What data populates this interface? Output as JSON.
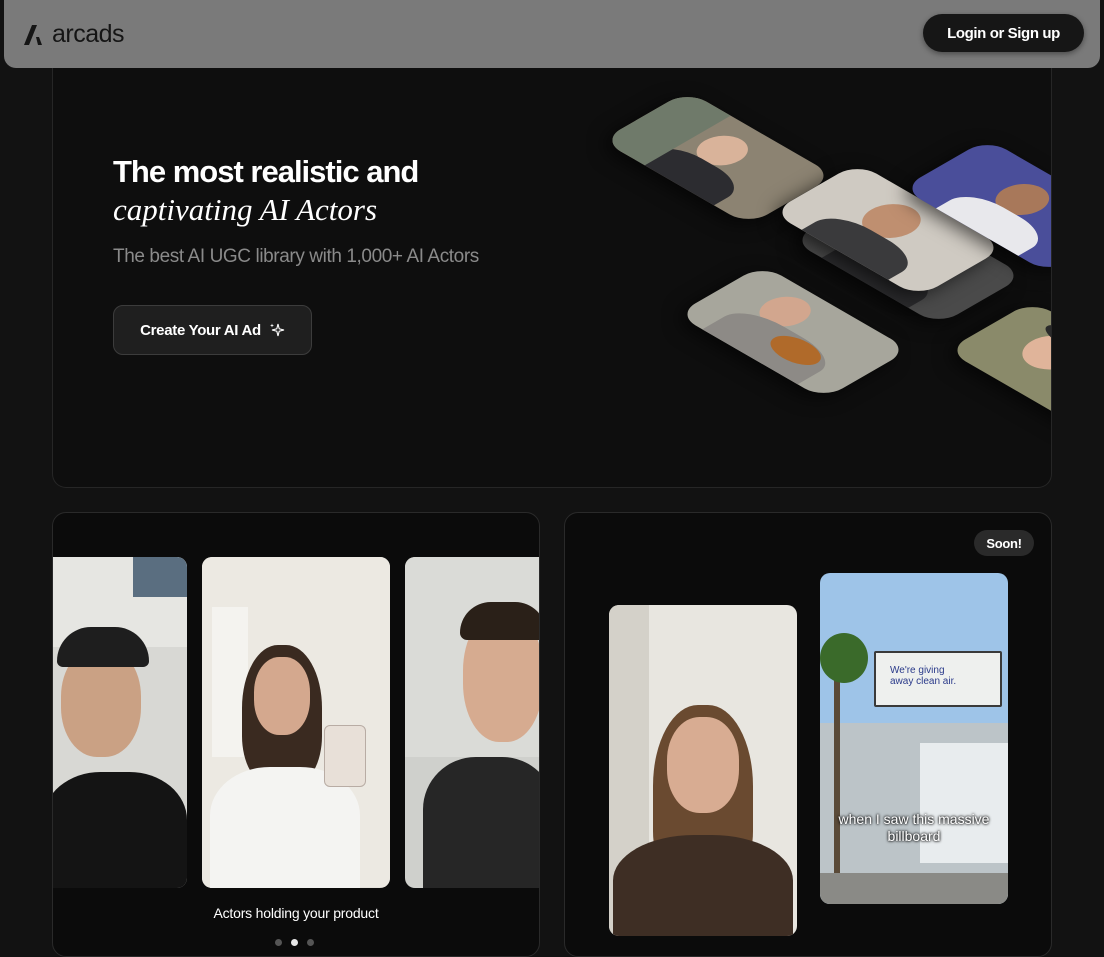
{
  "navbar": {
    "brand": "arcads",
    "login_label": "Login or Sign up"
  },
  "hero": {
    "title": "The most realistic and",
    "title_italic": "captivating AI Actors",
    "subtitle": "The best AI UGC library with 1,000+ AI Actors",
    "cta_label": "Create Your AI Ad",
    "cta_icon": "sparkle-icon"
  },
  "cards": {
    "left": {
      "caption": "Actors holding your product",
      "carousel": {
        "page_count": 3,
        "active_index": 1
      }
    },
    "right": {
      "badge": "Soon!",
      "billboard_text": "We're giving away clean air.",
      "subtitle": "when I saw this massive billboard"
    }
  },
  "colors": {
    "background": "#121212",
    "navbar": "#7a7a7a",
    "card": "#0b0b0b",
    "muted_text": "#8a8a8a"
  }
}
